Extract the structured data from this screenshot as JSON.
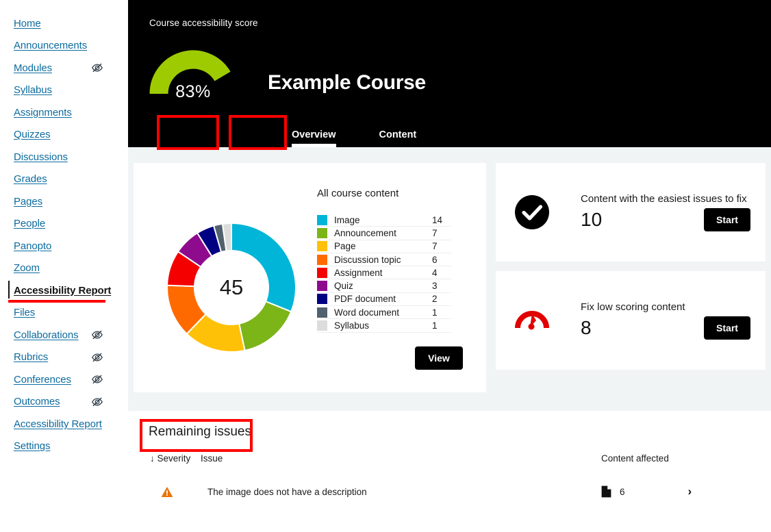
{
  "sidebar": {
    "items": [
      {
        "label": "Home",
        "hidden_icon": false,
        "active": false
      },
      {
        "label": "Announcements",
        "hidden_icon": false,
        "active": false
      },
      {
        "label": "Modules",
        "hidden_icon": true,
        "active": false
      },
      {
        "label": "Syllabus",
        "hidden_icon": false,
        "active": false
      },
      {
        "label": "Assignments",
        "hidden_icon": false,
        "active": false
      },
      {
        "label": "Quizzes",
        "hidden_icon": false,
        "active": false
      },
      {
        "label": "Discussions",
        "hidden_icon": false,
        "active": false
      },
      {
        "label": "Grades",
        "hidden_icon": false,
        "active": false
      },
      {
        "label": "Pages",
        "hidden_icon": false,
        "active": false
      },
      {
        "label": "People",
        "hidden_icon": false,
        "active": false
      },
      {
        "label": "Panopto",
        "hidden_icon": false,
        "active": false
      },
      {
        "label": "Zoom",
        "hidden_icon": false,
        "active": false
      },
      {
        "label": "Accessibility Report",
        "hidden_icon": false,
        "active": true
      },
      {
        "label": "Files",
        "hidden_icon": false,
        "active": false
      },
      {
        "label": "Collaborations",
        "hidden_icon": true,
        "active": false
      },
      {
        "label": "Rubrics",
        "hidden_icon": true,
        "active": false
      },
      {
        "label": "Conferences",
        "hidden_icon": true,
        "active": false
      },
      {
        "label": "Outcomes",
        "hidden_icon": true,
        "active": false
      },
      {
        "label": "Accessibility Report",
        "hidden_icon": false,
        "active": false
      },
      {
        "label": "Settings",
        "hidden_icon": false,
        "active": false
      }
    ],
    "hidden_icon_name": "eye-slash-icon"
  },
  "hero": {
    "score_label": "Course accessibility score",
    "score_percent_text": "83%",
    "score_percent_value": 83,
    "course_title": "Example Course",
    "gauge_color": "#9ecb00",
    "tabs": [
      {
        "label": "Overview",
        "active": true
      },
      {
        "label": "Content",
        "active": false
      }
    ]
  },
  "overview": {
    "legend_title": "All course content",
    "total": "45",
    "view_button": "View"
  },
  "chart_data": {
    "type": "pie",
    "title": "All course content",
    "center_label": "45",
    "categories": [
      "Image",
      "Announcement",
      "Page",
      "Discussion topic",
      "Assignment",
      "Quiz",
      "PDF document",
      "Word document",
      "Syllabus"
    ],
    "values": [
      14,
      7,
      7,
      6,
      4,
      3,
      2,
      1,
      1
    ],
    "colors": [
      "#00b5d8",
      "#7cb518",
      "#ffc107",
      "#ff6a00",
      "#f40000",
      "#8e0b8e",
      "#000082",
      "#52616e",
      "#dcdcdc"
    ],
    "total": 45,
    "legend_position": "right",
    "grid": false
  },
  "cards": [
    {
      "icon": "check-circle-icon",
      "title": "Content with the easiest issues to fix",
      "count": "10",
      "button": "Start"
    },
    {
      "icon": "gauge-low-score-icon",
      "title": "Fix low scoring content",
      "count": "8",
      "button": "Start"
    }
  ],
  "issues": {
    "title": "Remaining issues",
    "columns": {
      "severity": "↓ Severity",
      "issue": "Issue",
      "affected": "Content affected"
    },
    "rows": [
      {
        "severity_icon": "warning-triangle-icon",
        "issue": "The image does not have a description",
        "affected_icon": "document-icon",
        "affected_count": "6",
        "chevron": "›"
      }
    ]
  },
  "annotations": {
    "color": "#ff0000",
    "targets": [
      "sidebar-item-accessibility-report",
      "tab-overview",
      "tab-content",
      "issues-title"
    ]
  }
}
